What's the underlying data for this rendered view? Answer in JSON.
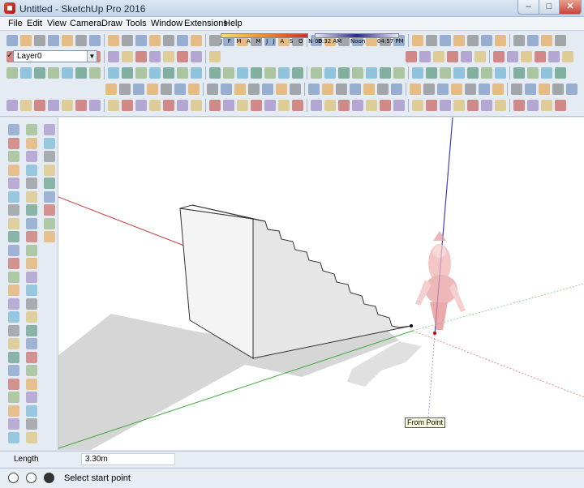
{
  "window": {
    "title": "Untitled - SketchUp Pro 2016",
    "minimize": "–",
    "maximize": "□",
    "close": "✕"
  },
  "menu": [
    "File",
    "Edit",
    "View",
    "Camera",
    "Draw",
    "Tools",
    "Window",
    "Extensions",
    "Help"
  ],
  "layer": {
    "check": "✓",
    "name": "Layer0",
    "dropdown": "▼"
  },
  "shadows": {
    "months": "J F M A M J J A S O N D",
    "time_start": "06:32 AM",
    "time_mid": "Noon",
    "time_end": "04:57 PM"
  },
  "viewport": {
    "tooltip": "From Point"
  },
  "measurements": {
    "label": "Length",
    "value": "3.30m"
  },
  "status": {
    "text": "Select start point"
  },
  "colors": {
    "red_axis": "#c84040",
    "green_axis": "#3aa63a",
    "blue_axis": "#3c3cd0",
    "toolbar_bg": "#e5ebf3",
    "accent_orange": "#e8962a"
  },
  "icons": {
    "toolbar": [
      "new-icon",
      "open-icon",
      "save-icon",
      "cut-icon",
      "copy-icon",
      "paste-icon",
      "erase-icon",
      "undo-icon",
      "redo-icon",
      "print-icon",
      "model-info-icon"
    ],
    "left": [
      "select-icon",
      "component-icon",
      "paint-bucket-icon",
      "eraser-icon",
      "line-icon",
      "arc-icon",
      "rectangle-icon",
      "circle-icon",
      "push-pull-icon",
      "move-icon",
      "rotate-icon",
      "scale-icon",
      "offset-icon",
      "tape-measure-icon",
      "text-icon",
      "axes-icon",
      "orbit-icon",
      "pan-icon",
      "zoom-icon",
      "walk-icon"
    ]
  }
}
